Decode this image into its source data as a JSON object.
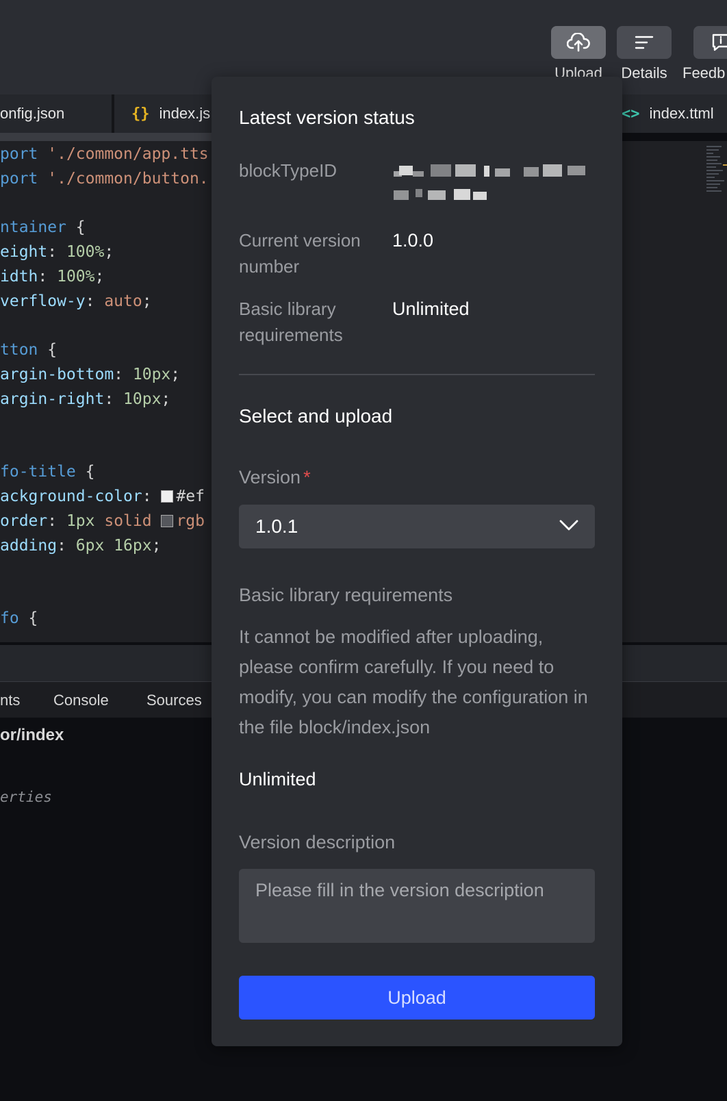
{
  "toolbar": {
    "upload_label": "Upload",
    "details_label": "Details",
    "feedback_label": "Feedb"
  },
  "tabs": [
    {
      "label": "onfig.json",
      "icon": "json-file-icon"
    },
    {
      "label": "index.js",
      "icon": "braces-icon",
      "icon_text": "{}"
    },
    {
      "label": "index.ttml",
      "icon": "code-brackets-icon",
      "icon_text": "<>"
    }
  ],
  "code": {
    "l1a": "port ",
    "l1b": "'./common/app.tts",
    "l2a": "port ",
    "l2b": "'./common/button.",
    "l3a": "ntainer",
    "l3b": " {",
    "l4a": "eight",
    "l4b": ": ",
    "l4c": "100%",
    "l4d": ";",
    "l5a": "idth",
    "l5b": ": ",
    "l5c": "100%",
    "l5d": ";",
    "l6a": "verflow-y",
    "l6b": ": ",
    "l6c": "auto",
    "l6d": ";",
    "l7a": "tton",
    "l7b": " {",
    "l8a": "argin-bottom",
    "l8b": ": ",
    "l8c": "10px",
    "l8d": ";",
    "l9a": "argin-right",
    "l9b": ": ",
    "l9c": "10px",
    "l9d": ";",
    "l10a": "fo-title",
    "l10b": " {",
    "l11a": "ackground-color",
    "l11b": ": ",
    "l11c": "#ef",
    "l12a": "order",
    "l12b": ": ",
    "l12c": "1px",
    "l12d": " solid ",
    "l12e": "rgb",
    "l13a": "adding",
    "l13b": ": ",
    "l13c": "6px 16px",
    "l13d": ";",
    "l14a": "fo",
    "l14b": " {"
  },
  "devtools": {
    "tabs": [
      "nts",
      "Console",
      "Sources"
    ],
    "path": "or/index",
    "properties": "erties"
  },
  "panel": {
    "status_title": "Latest version status",
    "block_type_id_label": "blockTypeID",
    "current_version_label": "Current version number",
    "current_version_value": "1.0.0",
    "basic_lib_label": "Basic library requirements",
    "basic_lib_value": "Unlimited",
    "select_title": "Select and upload",
    "version_label": "Version",
    "required_mark": "*",
    "version_selected": "1.0.1",
    "basic_lib_section_label": "Basic library requirements",
    "basic_lib_help": "It cannot be modified after uploading, please confirm carefully. If you need to modify, you can modify the configuration in the file block/index.json",
    "basic_lib_selected": "Unlimited",
    "description_label": "Version description",
    "description_placeholder": "Please fill in the version description",
    "description_value": "",
    "upload_button": "Upload"
  },
  "colors": {
    "accent": "#2b54ff",
    "required": "#e34d4d",
    "panel_bg": "#2b2d32"
  }
}
